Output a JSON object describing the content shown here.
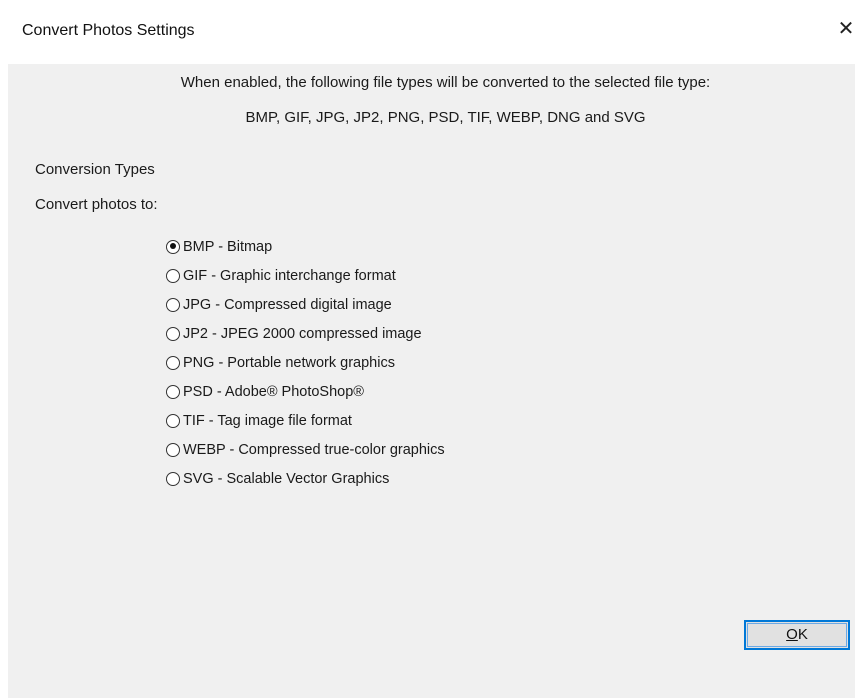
{
  "window": {
    "title": "Convert Photos Settings",
    "close_glyph": "✕",
    "close_icon": "close-icon"
  },
  "header": {
    "line1": "When enabled, the following file types will be converted to the selected file type:",
    "line2": "BMP, GIF, JPG, JP2, PNG, PSD, TIF, WEBP, DNG and SVG"
  },
  "sections": {
    "conversion_types": "Conversion Types",
    "convert_photos_to": "Convert photos to:"
  },
  "options": [
    {
      "label": "BMP - Bitmap",
      "checked": true
    },
    {
      "label": "GIF - Graphic interchange format",
      "checked": false
    },
    {
      "label": "JPG - Compressed digital image",
      "checked": false
    },
    {
      "label": "JP2 - JPEG 2000 compressed image",
      "checked": false
    },
    {
      "label": "PNG - Portable network graphics",
      "checked": false
    },
    {
      "label": "PSD - Adobe® PhotoShop®",
      "checked": false
    },
    {
      "label": "TIF - Tag image file format",
      "checked": false
    },
    {
      "label": "WEBP - Compressed true-color graphics",
      "checked": false
    },
    {
      "label": "SVG - Scalable Vector Graphics",
      "checked": false
    }
  ],
  "buttons": {
    "ok_mnemonic": "O",
    "ok_rest": "K"
  },
  "colors": {
    "client_bg": "#f0f0f0",
    "focus_border": "#0078d7"
  }
}
